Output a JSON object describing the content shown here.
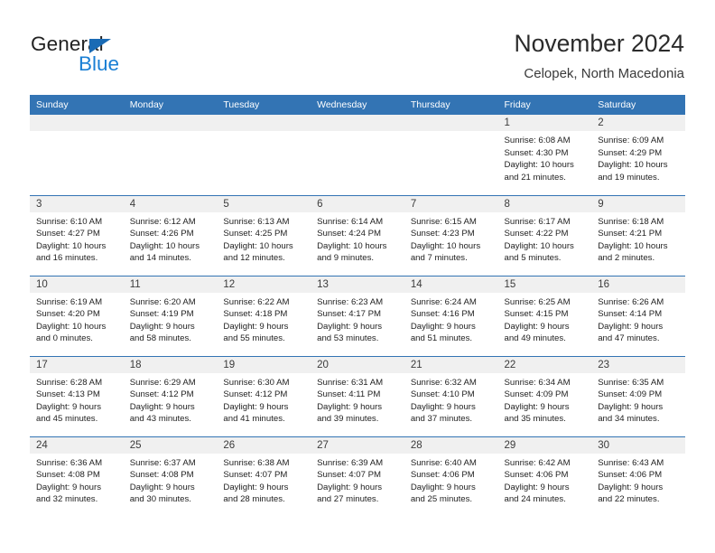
{
  "logo": {
    "word_one": "General",
    "word_two": "Blue",
    "triangle_color": "#1a6bb5",
    "blue_color": "#1a7fd4"
  },
  "header": {
    "title": "November 2024",
    "subtitle": "Celopek, North Macedonia"
  },
  "theme": {
    "header_blue": "#3374b4",
    "daynum_band": "#f0f0f0",
    "text": "#222222"
  },
  "calendar": {
    "weekday_headers": [
      "Sunday",
      "Monday",
      "Tuesday",
      "Wednesday",
      "Thursday",
      "Friday",
      "Saturday"
    ],
    "weeks": [
      [
        {
          "day": "",
          "sunrise": "",
          "sunset": "",
          "daylight_line1": "",
          "daylight_line2": ""
        },
        {
          "day": "",
          "sunrise": "",
          "sunset": "",
          "daylight_line1": "",
          "daylight_line2": ""
        },
        {
          "day": "",
          "sunrise": "",
          "sunset": "",
          "daylight_line1": "",
          "daylight_line2": ""
        },
        {
          "day": "",
          "sunrise": "",
          "sunset": "",
          "daylight_line1": "",
          "daylight_line2": ""
        },
        {
          "day": "",
          "sunrise": "",
          "sunset": "",
          "daylight_line1": "",
          "daylight_line2": ""
        },
        {
          "day": "1",
          "sunrise": "Sunrise: 6:08 AM",
          "sunset": "Sunset: 4:30 PM",
          "daylight_line1": "Daylight: 10 hours",
          "daylight_line2": "and 21 minutes."
        },
        {
          "day": "2",
          "sunrise": "Sunrise: 6:09 AM",
          "sunset": "Sunset: 4:29 PM",
          "daylight_line1": "Daylight: 10 hours",
          "daylight_line2": "and 19 minutes."
        }
      ],
      [
        {
          "day": "3",
          "sunrise": "Sunrise: 6:10 AM",
          "sunset": "Sunset: 4:27 PM",
          "daylight_line1": "Daylight: 10 hours",
          "daylight_line2": "and 16 minutes."
        },
        {
          "day": "4",
          "sunrise": "Sunrise: 6:12 AM",
          "sunset": "Sunset: 4:26 PM",
          "daylight_line1": "Daylight: 10 hours",
          "daylight_line2": "and 14 minutes."
        },
        {
          "day": "5",
          "sunrise": "Sunrise: 6:13 AM",
          "sunset": "Sunset: 4:25 PM",
          "daylight_line1": "Daylight: 10 hours",
          "daylight_line2": "and 12 minutes."
        },
        {
          "day": "6",
          "sunrise": "Sunrise: 6:14 AM",
          "sunset": "Sunset: 4:24 PM",
          "daylight_line1": "Daylight: 10 hours",
          "daylight_line2": "and 9 minutes."
        },
        {
          "day": "7",
          "sunrise": "Sunrise: 6:15 AM",
          "sunset": "Sunset: 4:23 PM",
          "daylight_line1": "Daylight: 10 hours",
          "daylight_line2": "and 7 minutes."
        },
        {
          "day": "8",
          "sunrise": "Sunrise: 6:17 AM",
          "sunset": "Sunset: 4:22 PM",
          "daylight_line1": "Daylight: 10 hours",
          "daylight_line2": "and 5 minutes."
        },
        {
          "day": "9",
          "sunrise": "Sunrise: 6:18 AM",
          "sunset": "Sunset: 4:21 PM",
          "daylight_line1": "Daylight: 10 hours",
          "daylight_line2": "and 2 minutes."
        }
      ],
      [
        {
          "day": "10",
          "sunrise": "Sunrise: 6:19 AM",
          "sunset": "Sunset: 4:20 PM",
          "daylight_line1": "Daylight: 10 hours",
          "daylight_line2": "and 0 minutes."
        },
        {
          "day": "11",
          "sunrise": "Sunrise: 6:20 AM",
          "sunset": "Sunset: 4:19 PM",
          "daylight_line1": "Daylight: 9 hours",
          "daylight_line2": "and 58 minutes."
        },
        {
          "day": "12",
          "sunrise": "Sunrise: 6:22 AM",
          "sunset": "Sunset: 4:18 PM",
          "daylight_line1": "Daylight: 9 hours",
          "daylight_line2": "and 55 minutes."
        },
        {
          "day": "13",
          "sunrise": "Sunrise: 6:23 AM",
          "sunset": "Sunset: 4:17 PM",
          "daylight_line1": "Daylight: 9 hours",
          "daylight_line2": "and 53 minutes."
        },
        {
          "day": "14",
          "sunrise": "Sunrise: 6:24 AM",
          "sunset": "Sunset: 4:16 PM",
          "daylight_line1": "Daylight: 9 hours",
          "daylight_line2": "and 51 minutes."
        },
        {
          "day": "15",
          "sunrise": "Sunrise: 6:25 AM",
          "sunset": "Sunset: 4:15 PM",
          "daylight_line1": "Daylight: 9 hours",
          "daylight_line2": "and 49 minutes."
        },
        {
          "day": "16",
          "sunrise": "Sunrise: 6:26 AM",
          "sunset": "Sunset: 4:14 PM",
          "daylight_line1": "Daylight: 9 hours",
          "daylight_line2": "and 47 minutes."
        }
      ],
      [
        {
          "day": "17",
          "sunrise": "Sunrise: 6:28 AM",
          "sunset": "Sunset: 4:13 PM",
          "daylight_line1": "Daylight: 9 hours",
          "daylight_line2": "and 45 minutes."
        },
        {
          "day": "18",
          "sunrise": "Sunrise: 6:29 AM",
          "sunset": "Sunset: 4:12 PM",
          "daylight_line1": "Daylight: 9 hours",
          "daylight_line2": "and 43 minutes."
        },
        {
          "day": "19",
          "sunrise": "Sunrise: 6:30 AM",
          "sunset": "Sunset: 4:12 PM",
          "daylight_line1": "Daylight: 9 hours",
          "daylight_line2": "and 41 minutes."
        },
        {
          "day": "20",
          "sunrise": "Sunrise: 6:31 AM",
          "sunset": "Sunset: 4:11 PM",
          "daylight_line1": "Daylight: 9 hours",
          "daylight_line2": "and 39 minutes."
        },
        {
          "day": "21",
          "sunrise": "Sunrise: 6:32 AM",
          "sunset": "Sunset: 4:10 PM",
          "daylight_line1": "Daylight: 9 hours",
          "daylight_line2": "and 37 minutes."
        },
        {
          "day": "22",
          "sunrise": "Sunrise: 6:34 AM",
          "sunset": "Sunset: 4:09 PM",
          "daylight_line1": "Daylight: 9 hours",
          "daylight_line2": "and 35 minutes."
        },
        {
          "day": "23",
          "sunrise": "Sunrise: 6:35 AM",
          "sunset": "Sunset: 4:09 PM",
          "daylight_line1": "Daylight: 9 hours",
          "daylight_line2": "and 34 minutes."
        }
      ],
      [
        {
          "day": "24",
          "sunrise": "Sunrise: 6:36 AM",
          "sunset": "Sunset: 4:08 PM",
          "daylight_line1": "Daylight: 9 hours",
          "daylight_line2": "and 32 minutes."
        },
        {
          "day": "25",
          "sunrise": "Sunrise: 6:37 AM",
          "sunset": "Sunset: 4:08 PM",
          "daylight_line1": "Daylight: 9 hours",
          "daylight_line2": "and 30 minutes."
        },
        {
          "day": "26",
          "sunrise": "Sunrise: 6:38 AM",
          "sunset": "Sunset: 4:07 PM",
          "daylight_line1": "Daylight: 9 hours",
          "daylight_line2": "and 28 minutes."
        },
        {
          "day": "27",
          "sunrise": "Sunrise: 6:39 AM",
          "sunset": "Sunset: 4:07 PM",
          "daylight_line1": "Daylight: 9 hours",
          "daylight_line2": "and 27 minutes."
        },
        {
          "day": "28",
          "sunrise": "Sunrise: 6:40 AM",
          "sunset": "Sunset: 4:06 PM",
          "daylight_line1": "Daylight: 9 hours",
          "daylight_line2": "and 25 minutes."
        },
        {
          "day": "29",
          "sunrise": "Sunrise: 6:42 AM",
          "sunset": "Sunset: 4:06 PM",
          "daylight_line1": "Daylight: 9 hours",
          "daylight_line2": "and 24 minutes."
        },
        {
          "day": "30",
          "sunrise": "Sunrise: 6:43 AM",
          "sunset": "Sunset: 4:06 PM",
          "daylight_line1": "Daylight: 9 hours",
          "daylight_line2": "and 22 minutes."
        }
      ]
    ]
  }
}
